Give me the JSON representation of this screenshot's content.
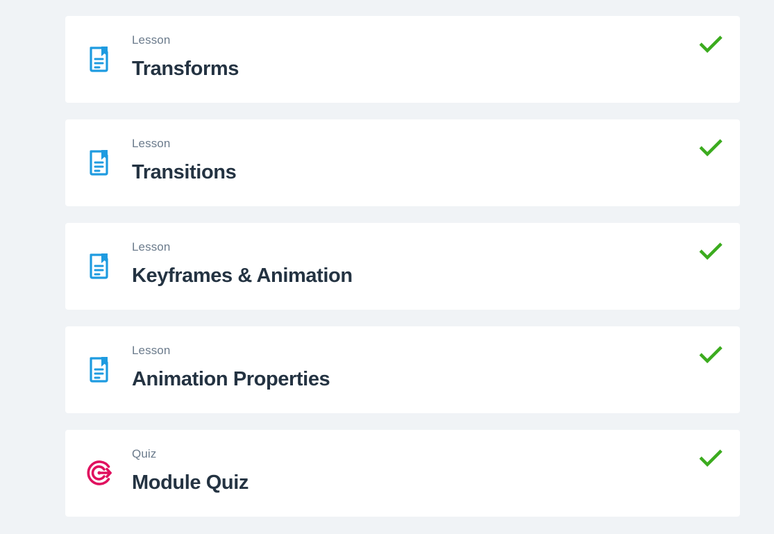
{
  "items": [
    {
      "type": "Lesson",
      "title": "Transforms",
      "icon": "lesson-document-icon",
      "completed": true
    },
    {
      "type": "Lesson",
      "title": "Transitions",
      "icon": "lesson-document-icon",
      "completed": true
    },
    {
      "type": "Lesson",
      "title": "Keyframes & Animation",
      "icon": "lesson-document-icon",
      "completed": true
    },
    {
      "type": "Lesson",
      "title": "Animation Properties",
      "icon": "lesson-document-icon",
      "completed": true
    },
    {
      "type": "Quiz",
      "title": "Module Quiz",
      "icon": "quiz-target-icon",
      "completed": true
    }
  ],
  "colors": {
    "background": "#f0f3f6",
    "card": "#ffffff",
    "lesson_icon": "#1e9be0",
    "quiz_icon": "#e0115f",
    "check": "#3bab1e",
    "type_text": "#6b7b8c",
    "title_text": "#243342"
  }
}
